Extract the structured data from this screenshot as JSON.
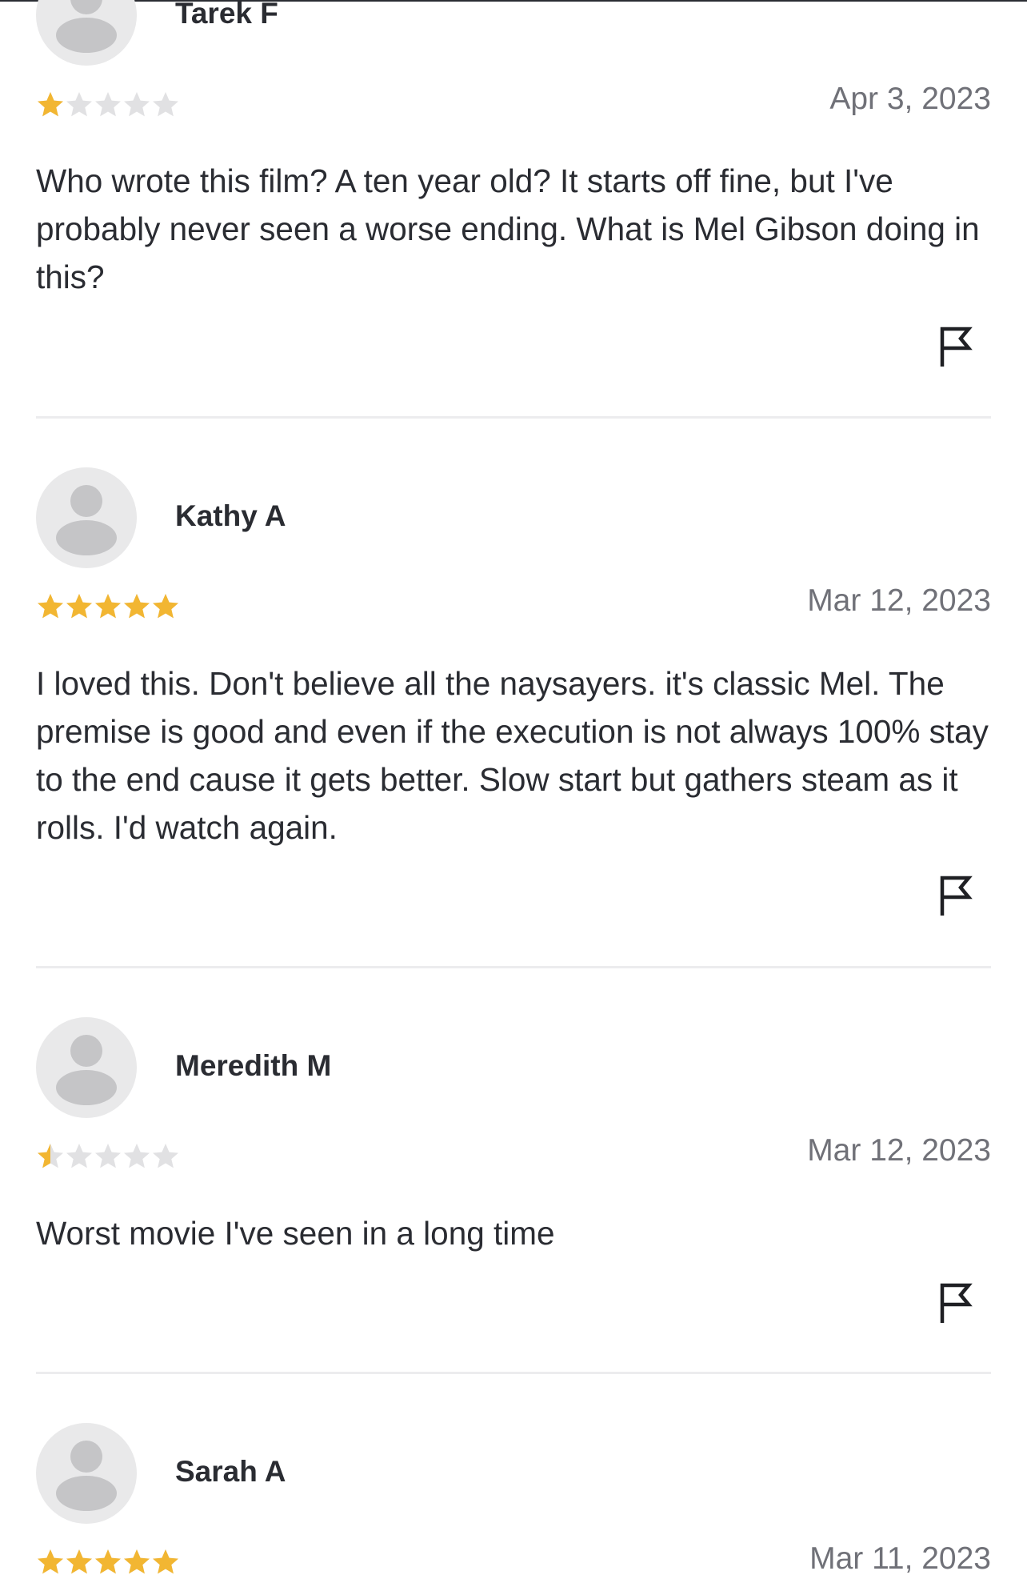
{
  "colors": {
    "star_filled": "#f2b632",
    "star_empty": "#e1e1e3",
    "avatar_bg": "#e9e9ea",
    "avatar_figure": "#c5c5c7",
    "text": "#2a2c32",
    "date_text": "#707178"
  },
  "reviews": [
    {
      "username": "Tarek F",
      "rating": 1,
      "date": "Apr 3, 2023",
      "text": "Who wrote this film? A ten year old? It starts off fine, but I've probably never seen a worse ending. What is Mel Gibson doing in this?",
      "avatar_icon": "user-placeholder-icon",
      "report_icon": "flag-icon"
    },
    {
      "username": "Kathy A",
      "rating": 5,
      "date": "Mar 12, 2023",
      "text": "I loved this. Don't believe all the naysayers. it's classic Mel. The premise is good and even if the execution is not always 100% stay to the end cause it gets better. Slow start but gathers steam as it rolls. I'd watch again.",
      "avatar_icon": "user-placeholder-icon",
      "report_icon": "flag-icon"
    },
    {
      "username": "Meredith M",
      "rating": 0.5,
      "date": "Mar 12, 2023",
      "text": "Worst movie I've seen in a long time",
      "avatar_icon": "user-placeholder-icon",
      "report_icon": "flag-icon"
    },
    {
      "username": "Sarah A",
      "rating": 5,
      "date": "Mar 11, 2023",
      "text": "",
      "avatar_icon": "user-placeholder-icon",
      "report_icon": "flag-icon"
    }
  ]
}
